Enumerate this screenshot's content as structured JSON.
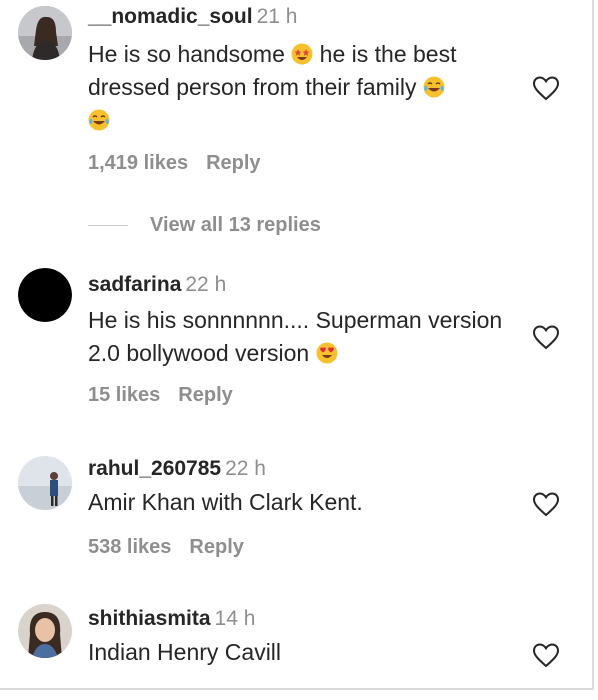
{
  "comments": [
    {
      "username": "__nomadic_soul",
      "time": "21 h",
      "text_part1": "He is so handsome",
      "text_part2": "he is the best dressed person from their family",
      "likes": "1,419 likes",
      "reply": "Reply",
      "view_replies": "View all 13 replies",
      "emojis": [
        "star-struck-emoji",
        "tears-of-joy-emoji",
        "tears-of-joy-emoji"
      ]
    },
    {
      "username": "sadfarina",
      "time": "22 h",
      "text": "He is his sonnnnnn.... Superman version 2.0 bollywood version",
      "likes": "15 likes",
      "reply": "Reply",
      "emojis": [
        "heart-eyes-emoji"
      ]
    },
    {
      "username": "rahul_260785",
      "time": "22 h",
      "text": "Amir Khan with Clark Kent.",
      "likes": "538 likes",
      "reply": "Reply"
    },
    {
      "username": "shithiasmita",
      "time": "14 h",
      "text": "Indian Henry Cavill"
    }
  ],
  "colors": {
    "text": "#262626",
    "muted": "#8e8e8e",
    "divider": "#c7c7c7",
    "emoji": "#f7c12e"
  }
}
